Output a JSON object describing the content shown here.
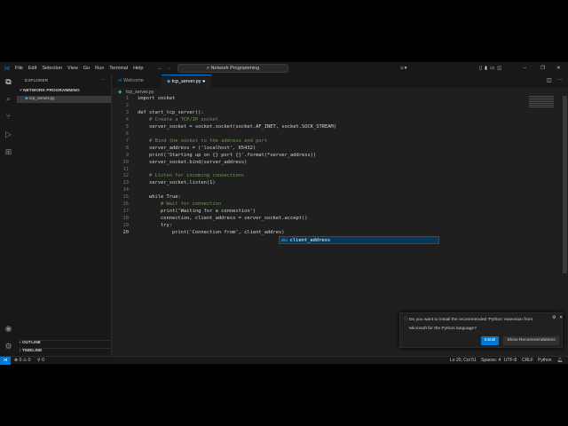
{
  "menu": [
    "File",
    "Edit",
    "Selection",
    "View",
    "Go",
    "Run",
    "Terminal",
    "Help"
  ],
  "search": "Network Programming",
  "sidebar": {
    "title": "EXPLORER",
    "folder": "NETWORK PROGRAMMING",
    "file": "tcp_server.py",
    "outline": "OUTLINE",
    "timeline": "TIMELINE"
  },
  "tabs": [
    {
      "label": "Welcome"
    },
    {
      "label": "tcp_server.py"
    }
  ],
  "breadcrumb": "tcp_server.py",
  "code": [
    "import socket",
    "",
    "def start_tcp_server():",
    "    # Create a TCP/IP socket",
    "    server_socket = socket.socket(socket.AF_INET, socket.SOCK_STREAM)",
    "",
    "    # Bind the socket to the address and port",
    "    server_address = ('localhost', 65432)",
    "    print('Starting up on {} port {}'.format(*server_address))",
    "    server_socket.bind(server_address)",
    "",
    "    # Listen for incoming connections",
    "    server_socket.listen(1)",
    "",
    "    while True:",
    "        # Wait for connection",
    "        print('Waiting for a connection')",
    "        connection, client_address = server_socket.accept()",
    "        try:",
    "            print('Connection from', client_addres)"
  ],
  "suggestion": "client_address",
  "notification": {
    "message": "Do you want to install the recommended 'Python' extension from Microsoft for the Python language?",
    "install": "Install",
    "show": "Show Recommendations"
  },
  "status": {
    "errors": "0",
    "warnings": "0",
    "ports": "0",
    "position": "Ln 20, Col 51",
    "spaces": "Spaces: 4",
    "encoding": "UTF-8",
    "eol": "CRLF",
    "language": "Python"
  },
  "colors": {
    "accent": "#0078d4"
  }
}
